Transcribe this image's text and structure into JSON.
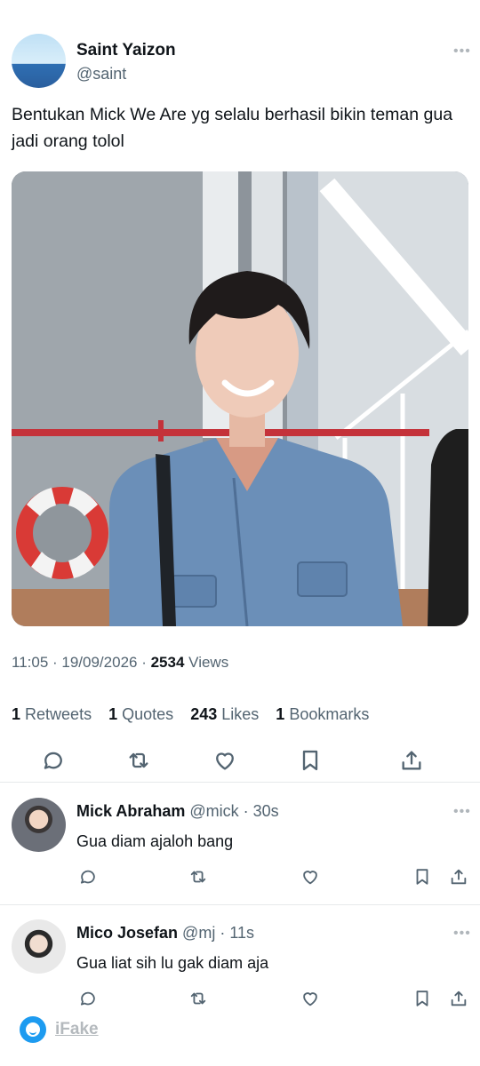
{
  "tweet": {
    "author_name": "Saint Yaizon",
    "author_handle": "@saint",
    "text": "Bentukan Mick We Are yg selalu berhasil bikin teman gua jadi orang tolol",
    "more_icon": "more-horizontal-icon",
    "media": "photo of a smiling young man in a denim jacket in front of a staircase and life ring",
    "time": "11:05",
    "date": "19/09/2026",
    "views_count": "2534",
    "views_label": "Views",
    "stats": {
      "retweets_count": "1",
      "retweets_label": "Retweets",
      "quotes_count": "1",
      "quotes_label": "Quotes",
      "likes_count": "243",
      "likes_label": "Likes",
      "bookmarks_count": "1",
      "bookmarks_label": "Bookmarks"
    },
    "actions": [
      "reply-icon",
      "retweet-icon",
      "like-icon",
      "bookmark-icon",
      "share-icon"
    ]
  },
  "replies": [
    {
      "name": "Mick Abraham",
      "handle": "@mick",
      "time": "30s",
      "text": "Gua diam ajaloh bang"
    },
    {
      "name": "Mico Josefan",
      "handle": "@mj",
      "time": "11s",
      "text": "Gua liat sih lu gak diam aja"
    }
  ],
  "separator": " · ",
  "watermark": {
    "text": "iFake"
  },
  "colors": {
    "text": "#0f1419",
    "secondary": "#536471",
    "accent": "#1d9bf0",
    "divider": "#e6e9eb"
  }
}
